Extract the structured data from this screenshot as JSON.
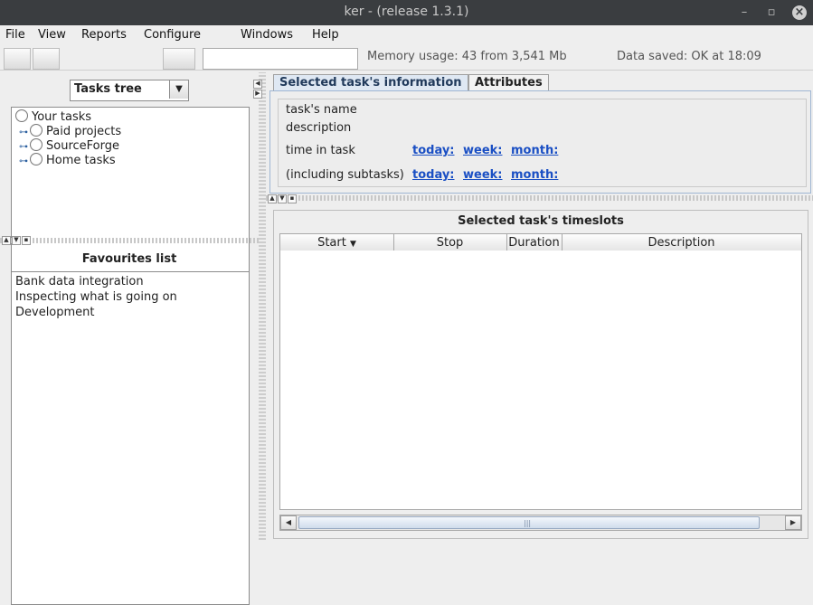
{
  "window": {
    "title": "ker - (release 1.3.1)",
    "controls": [
      "minimize-icon",
      "restore-icon",
      "close-icon"
    ]
  },
  "menu": {
    "items": [
      "File",
      "View",
      "Reports",
      "Configure",
      "Windows",
      "Help"
    ]
  },
  "toolbar": {
    "filter_value": "",
    "memory_usage": "Memory usage: 43 from 3,541 Mb",
    "data_saved": "Data saved: OK at 18:09"
  },
  "left": {
    "tree_selector": {
      "selected": "Tasks tree"
    },
    "tree": {
      "root": "Your tasks",
      "children": [
        "Paid projects",
        "SourceForge",
        "Home tasks"
      ]
    },
    "favourites": {
      "title": "Favourites list",
      "items": [
        "Bank data integration",
        "Inspecting what is going on",
        "Development"
      ]
    }
  },
  "right": {
    "tabs": [
      "Selected task's information",
      "Attributes"
    ],
    "info": {
      "task_name_label": "task's name",
      "description_label": "description",
      "time_in_task_label": "time in task",
      "including_subtasks_label": "(including subtasks)",
      "links_row1": [
        "today:",
        "week:",
        "month:"
      ],
      "links_row2": [
        "today:",
        "week:",
        "month:"
      ]
    },
    "timeslots": {
      "title": "Selected task's timeslots",
      "columns": [
        "Start",
        "Stop",
        "Duration",
        "Description"
      ]
    }
  },
  "colors": {
    "link": "#1a4fc4",
    "titlebar": "#3a3d40",
    "active_tab": "#dfe8f3"
  }
}
